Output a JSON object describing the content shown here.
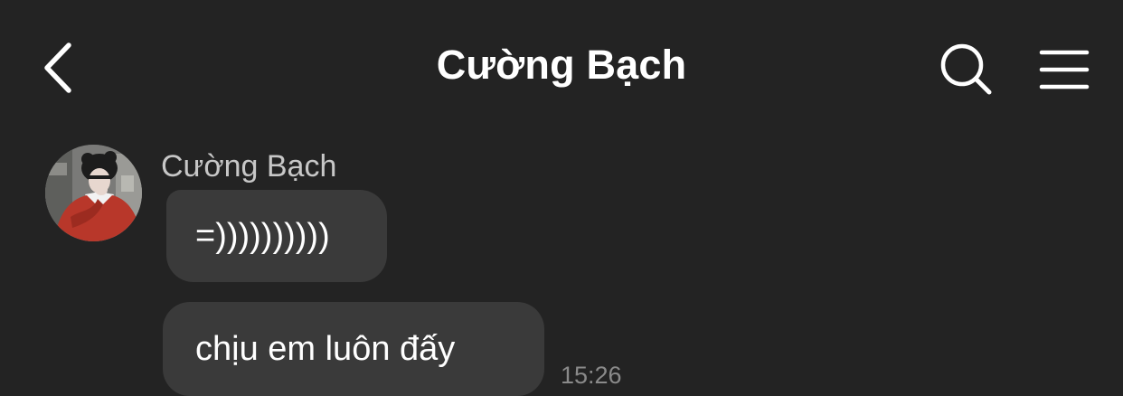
{
  "header": {
    "title": "Cường Bạch",
    "back_icon": "chevron-left-icon",
    "search_icon": "search-icon",
    "menu_icon": "hamburger-menu-icon"
  },
  "conversation": {
    "sender_name": "Cường Bạch",
    "avatar_icon": "user-avatar",
    "messages": [
      {
        "text": "=))))))))))"
      },
      {
        "text": "chịu em luôn đấy"
      }
    ],
    "timestamp": "15:26"
  },
  "colors": {
    "background": "#232323",
    "bubble": "#3a3a3a",
    "text": "#ffffff",
    "sender_name": "#c7c7c7",
    "timestamp": "#8a8a8a"
  }
}
